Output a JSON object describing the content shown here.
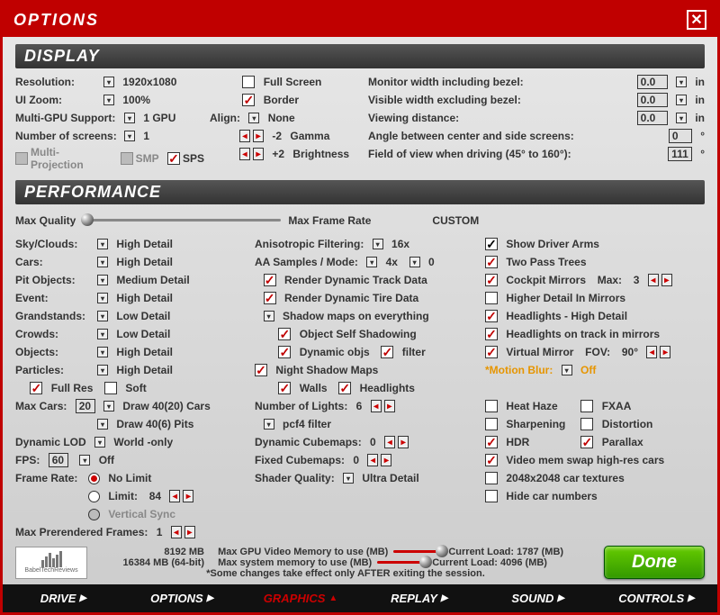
{
  "window": {
    "title": "OPTIONS"
  },
  "sections": {
    "display": "DISPLAY",
    "performance": "PERFORMANCE"
  },
  "display": {
    "resolution_label": "Resolution:",
    "resolution_value": "1920x1080",
    "uizoom_label": "UI Zoom:",
    "uizoom_value": "100%",
    "multigpu_label": "Multi-GPU Support:",
    "multigpu_value": "1 GPU",
    "screens_label": "Number of screens:",
    "screens_value": "1",
    "multiproj": "Multi-Projection",
    "smp": "SMP",
    "sps": "SPS",
    "fullscreen": "Full Screen",
    "border": "Border",
    "align_label": "Align:",
    "align_value": "None",
    "gamma_value": "-2",
    "gamma": "Gamma",
    "bright_value": "+2",
    "bright": "Brightness",
    "mon_width": "Monitor width including bezel:",
    "vis_width": "Visible width excluding bezel:",
    "view_dist": "Viewing distance:",
    "angle": "Angle between center and side screens:",
    "fov": "Field of view when driving (45° to 160°):",
    "val_0": "0.0",
    "val_in": "in",
    "val_0d": "0",
    "val_deg": "°",
    "val_111": "111"
  },
  "perf": {
    "maxq": "Max Quality",
    "maxfr": "Max Frame Rate",
    "custom": "CUSTOM",
    "sky": "Sky/Clouds:",
    "cars": "Cars:",
    "pit": "Pit Objects:",
    "event": "Event:",
    "grand": "Grandstands:",
    "crowds": "Crowds:",
    "objects": "Objects:",
    "particles": "Particles:",
    "high": "High Detail",
    "med": "Medium Detail",
    "low": "Low Detail",
    "fullres": "Full Res",
    "soft": "Soft",
    "maxcars": "Max Cars:",
    "maxcars_v": "20",
    "drawcars": "Draw 40(20) Cars",
    "drawpits": "Draw 40(6) Pits",
    "dynlod": "Dynamic LOD",
    "world": "World -only",
    "fps": "FPS:",
    "fps_v": "60",
    "off": "Off",
    "framerate": "Frame Rate:",
    "nolimit": "No Limit",
    "limit": "Limit:",
    "limit_v": "84",
    "vsync": "Vertical Sync",
    "prerender": "Max Prerendered Frames:",
    "prerender_v": "1",
    "aniso": "Anisotropic Filtering:",
    "aniso_v": "16x",
    "aa": "AA Samples / Mode:",
    "aa_s": "4x",
    "aa_m": "0",
    "rdtrack": "Render Dynamic Track Data",
    "rdtire": "Render Dynamic Tire Data",
    "shadowmaps": "Shadow maps on everything",
    "objself": "Object Self Shadowing",
    "dynobjs": "Dynamic objs",
    "filter": "filter",
    "nightshadow": "Night Shadow Maps",
    "walls": "Walls",
    "headlights": "Headlights",
    "numlights": "Number of Lights:",
    "numlights_v": "6",
    "pcf4": "pcf4 filter",
    "dyncube": "Dynamic Cubemaps:",
    "dyncube_v": "0",
    "fixedcube": "Fixed Cubemaps:",
    "fixedcube_v": "0",
    "shaderq": "Shader Quality:",
    "shaderq_v": "Ultra Detail",
    "driverarms": "Show Driver Arms",
    "twopass": "Two Pass Trees",
    "cockpit": "Cockpit Mirrors",
    "cockpit_max": "Max:",
    "cockpit_v": "3",
    "higherdetail": "Higher Detail In Mirrors",
    "headlightshd": "Headlights - High Detail",
    "headtrack": "Headlights on track in mirrors",
    "virtmirror": "Virtual Mirror",
    "virtfov": "FOV:",
    "virtfov_v": "90°",
    "motionblur": "*Motion Blur:",
    "mb_off": "Off",
    "heathaze": "Heat Haze",
    "fxaa": "FXAA",
    "sharpen": "Sharpening",
    "distortion": "Distortion",
    "hdr": "HDR",
    "parallax": "Parallax",
    "vidswap": "Video mem swap high-res cars",
    "cartex": "2048x2048 car textures",
    "hidecar": "Hide car numbers",
    "gpu_v": "8192 MB",
    "gpu_label": "Max GPU Video Memory to use (MB)",
    "gpu_load": "Current Load: 1787 (MB)",
    "sys_v": "16384 MB (64-bit)",
    "sys_label": "Max system memory to use (MB)",
    "sys_load": "Current Load: 4096 (MB)",
    "note": "*Some changes take effect only AFTER exiting the session."
  },
  "buttons": {
    "done": "Done"
  },
  "tabs": [
    "DRIVE",
    "OPTIONS",
    "GRAPHICS",
    "REPLAY",
    "SOUND",
    "CONTROLS"
  ],
  "active_tab": "GRAPHICS"
}
